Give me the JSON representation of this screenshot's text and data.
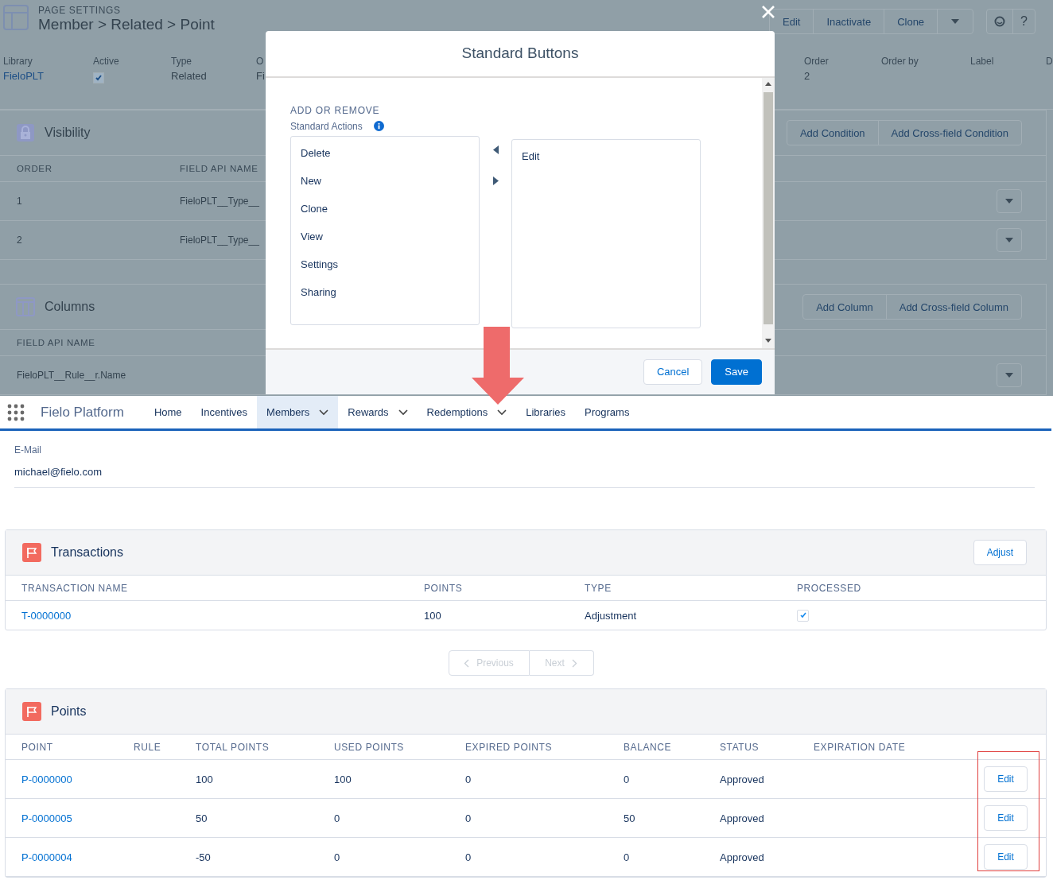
{
  "background_page": {
    "eyebrow": "PAGE SETTINGS",
    "title": "Member > Related > Point",
    "actions": [
      "Edit",
      "Inactivate",
      "Clone"
    ],
    "help": "?",
    "fields": [
      {
        "label": "Library",
        "kind": "link",
        "value": "FieloPLT"
      },
      {
        "label": "Active",
        "kind": "checkbox",
        "checked": true
      },
      {
        "label": "Type",
        "kind": "text",
        "value": "Related"
      },
      {
        "label": "O",
        "kind": "text",
        "value": "Fi"
      },
      {
        "label": "Order",
        "kind": "text",
        "value": "2"
      },
      {
        "label": "Order by",
        "kind": "empty"
      },
      {
        "label": "Label",
        "kind": "empty"
      },
      {
        "label": "D",
        "kind": "empty"
      }
    ],
    "visibility": {
      "title": "Visibility",
      "buttons": [
        "Add Condition",
        "Add Cross-field Condition"
      ],
      "columns": [
        "ORDER",
        "FIELD API NAME"
      ],
      "rows": [
        [
          "1",
          "FieloPLT__Type__"
        ],
        [
          "2",
          "FieloPLT__Type__"
        ]
      ]
    },
    "columns_panel": {
      "title": "Columns",
      "buttons": [
        "Add Column",
        "Add Cross-field Column"
      ],
      "columns": [
        "FIELD API NAME"
      ],
      "rows": [
        [
          "FieloPLT__Rule__r.Name"
        ]
      ]
    }
  },
  "modal": {
    "title": "Standard Buttons",
    "section": "ADD OR REMOVE",
    "label": "Standard Actions",
    "available": [
      "Delete",
      "New",
      "Clone",
      "View",
      "Settings",
      "Sharing"
    ],
    "chosen": [
      "Edit"
    ],
    "cancel": "Cancel",
    "save": "Save"
  },
  "nav": {
    "app_name": "Fielo Platform",
    "tabs": [
      {
        "label": "Home",
        "selected": false,
        "menu": false
      },
      {
        "label": "Incentives",
        "selected": false,
        "menu": false
      },
      {
        "label": "Members",
        "selected": true,
        "menu": true
      },
      {
        "label": "Rewards",
        "selected": false,
        "menu": true
      },
      {
        "label": "Redemptions",
        "selected": false,
        "menu": true
      },
      {
        "label": "Libraries",
        "selected": false,
        "menu": false
      },
      {
        "label": "Programs",
        "selected": false,
        "menu": false
      }
    ]
  },
  "member_field": {
    "label": "E-Mail",
    "value": "michael@fielo.com"
  },
  "transactions": {
    "title": "Transactions",
    "button": "Adjust",
    "columns": [
      "TRANSACTION NAME",
      "POINTS",
      "TYPE",
      "PROCESSED"
    ],
    "rows": [
      {
        "name": "T-0000000",
        "points": "100",
        "type": "Adjustment",
        "processed": true
      }
    ]
  },
  "pagination": {
    "previous": "Previous",
    "next": "Next",
    "disabled": true
  },
  "points": {
    "title": "Points",
    "columns": [
      "POINT",
      "RULE",
      "TOTAL POINTS",
      "USED POINTS",
      "EXPIRED POINTS",
      "BALANCE",
      "STATUS",
      "EXPIRATION DATE"
    ],
    "rows": [
      {
        "cells": [
          "P-0000000",
          "",
          "100",
          "100",
          "0",
          "0",
          "Approved",
          ""
        ],
        "action": "Edit"
      },
      {
        "cells": [
          "P-0000005",
          "",
          "50",
          "0",
          "0",
          "50",
          "Approved",
          ""
        ],
        "action": "Edit"
      },
      {
        "cells": [
          "P-0000004",
          "",
          "-50",
          "0",
          "0",
          "0",
          "Approved",
          ""
        ],
        "action": "Edit"
      }
    ],
    "actions_highlighted": true
  }
}
